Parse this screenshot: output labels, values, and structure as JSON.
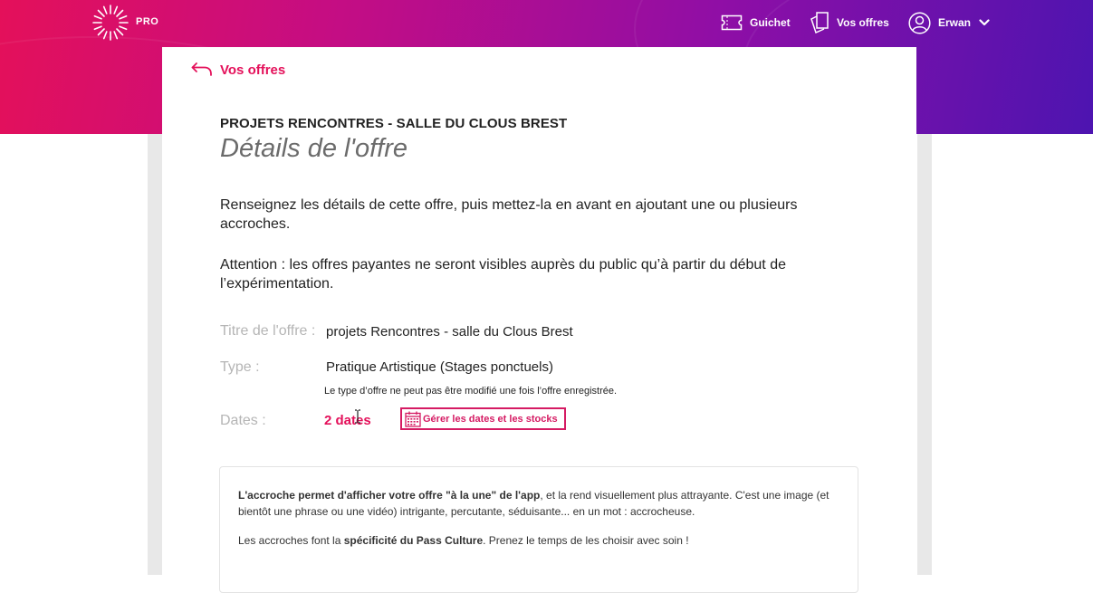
{
  "header": {
    "logo_text": "PRO",
    "nav": {
      "guichet": "Guichet",
      "offers": "Vos offres",
      "user": "Erwan"
    }
  },
  "back_link": "Vos offres",
  "venue_title": "PROJETS RENCONTRES - SALLE DU CLOUS BREST",
  "page_title": "Détails de l'offre",
  "intro": "Renseignez les détails de cette offre, puis mettez-la en avant en ajoutant une ou plusieurs accroches.",
  "warning": "Attention : les offres payantes ne seront visibles auprès du public qu’à partir du début de l’expérimentation.",
  "fields": {
    "title_label": "Titre de l'offre :",
    "title_value": "projets Rencontres - salle du Clous Brest",
    "type_label": "Type :",
    "type_value": "Pratique Artistique (Stages ponctuels)",
    "type_note": "Le type d’offre ne peut pas être modifié une fois l’offre enregistrée.",
    "dates_label": "Dates :",
    "dates_value": "2 dates",
    "manage_button": "Gérer les dates et les stocks"
  },
  "info_box": {
    "p1_bold": "L'accroche permet d'afficher votre offre \"à la une\" de l'app",
    "p1_rest": ", et la rend visuellement plus attrayante. C'est une image (et bientôt une phrase ou une vidéo) intrigante, percutante, séduisante... en un mot : accrocheuse.",
    "p2_start": "Les accroches font la ",
    "p2_bold": "spécificité du Pass Culture",
    "p2_end": ". Prenez le temps de les choisir avec soin !"
  },
  "colors": {
    "accent": "#e4105a",
    "header_gradient": [
      "#e4105a",
      "#8f0ea6",
      "#4d14b0"
    ]
  },
  "icons": {
    "logo": "sun-burst-logo",
    "guichet": "ticket-icon",
    "offers": "offers-cards-icon",
    "user": "user-circle-icon",
    "user_menu": "chevron-down-icon",
    "back": "back-arrow-icon",
    "manage": "calendar-icon"
  }
}
